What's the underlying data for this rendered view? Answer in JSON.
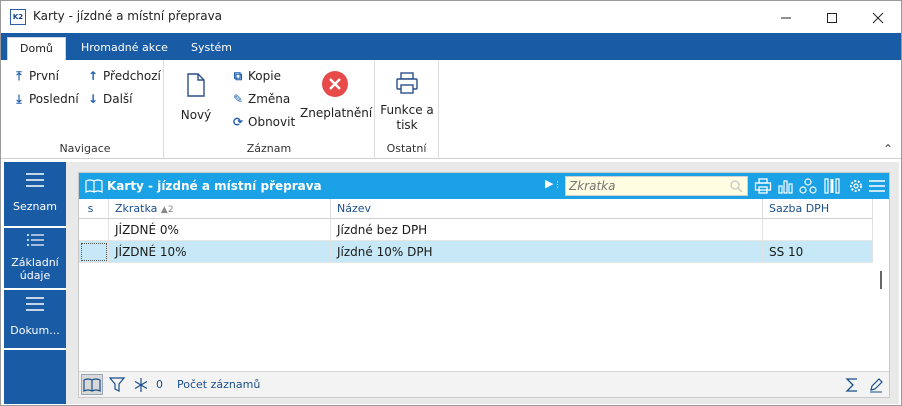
{
  "window": {
    "title": "Karty - jízdné a místní přeprava",
    "app_icon_text": "K2"
  },
  "ribbon_tabs": [
    {
      "label": "Domů",
      "active": true
    },
    {
      "label": "Hromadné akce",
      "active": false
    },
    {
      "label": "Systém",
      "active": false
    }
  ],
  "groups": {
    "navigace": {
      "label": "Navigace",
      "first": "První",
      "last": "Poslední",
      "prev": "Předchozí",
      "next": "Další"
    },
    "zaznam": {
      "label": "Záznam",
      "new": "Nový",
      "copy": "Kopie",
      "change": "Změna",
      "refresh": "Obnovit",
      "invalidate": "Zneplatnění"
    },
    "ostatni": {
      "label": "Ostatní",
      "print_line1": "Funkce a",
      "print_line2": "tisk"
    }
  },
  "leftnav": [
    {
      "label": "Seznam"
    },
    {
      "label_line1": "Základní",
      "label_line2": "údaje"
    },
    {
      "label": "Dokum..."
    }
  ],
  "panel": {
    "title": "Karty - jízdné a místní přeprava",
    "search_placeholder": "Zkratka"
  },
  "grid": {
    "columns": [
      {
        "label": "s"
      },
      {
        "label": "Zkratka",
        "sort": "▲",
        "sort_index": "2"
      },
      {
        "label": "Název"
      },
      {
        "label": "Sazba DPH"
      }
    ],
    "rows": [
      {
        "zkratka": "JÍZDNÉ 0%",
        "nazev": "Jízdné bez DPH",
        "sazba": ""
      },
      {
        "zkratka": "JÍZDNÉ 10%",
        "nazev": "Jízdné 10% DPH",
        "sazba": "SS 10"
      }
    ]
  },
  "statusbar": {
    "count": "0",
    "records_label": "Počet záznamů"
  },
  "colors": {
    "ribbon": "#1a5ba6",
    "panel_header": "#1aa1e6",
    "selected_row": "#c7e8f7",
    "search_bg": "#fffde1",
    "invalidate_red": "#e84a4a"
  }
}
